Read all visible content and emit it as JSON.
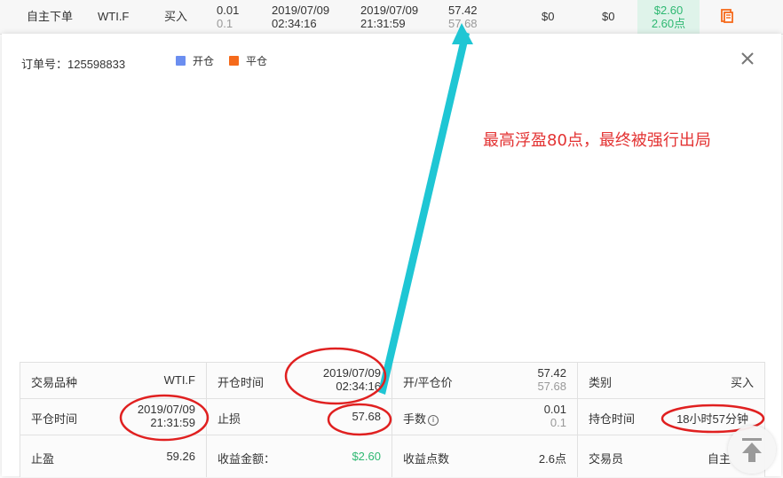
{
  "top_row": {
    "type": "自主下单",
    "symbol": "WTI.F",
    "direction": "买入",
    "lots": "0.01",
    "lots_sub": "0.1",
    "open_date": "2019/07/09",
    "open_time": "02:34:16",
    "close_date": "2019/07/09",
    "close_time": "21:31:59",
    "price_open": "57.42",
    "price_close": "57.68",
    "fee1": "$0",
    "fee2": "$0",
    "profit": "$2.60",
    "profit_points": "2.60点",
    "icon": "document-icon"
  },
  "modal": {
    "order_label": "订单号：125598833",
    "legend": [
      {
        "label": "开仓",
        "color": "#6b8ef0"
      },
      {
        "label": "平仓",
        "color": "#f56a1b"
      }
    ],
    "close_icon": "close-icon",
    "annotation": "最高浮盈80点，最终被强行出局"
  },
  "details": {
    "row1": {
      "symbol_label": "交易品种",
      "symbol_value": "WTI.F",
      "open_time_label": "开仓时间",
      "open_date": "2019/07/09",
      "open_time": "02:34:16",
      "price_label": "开/平仓价",
      "price_open": "57.42",
      "price_close": "57.68",
      "category_label": "类别",
      "category_value": "买入"
    },
    "row2": {
      "close_time_label": "平仓时间",
      "close_date": "2019/07/09",
      "close_time": "21:31:59",
      "stop_loss_label": "止损",
      "stop_loss_value": "57.68",
      "lots_label": "手数",
      "lots_value": "0.01",
      "lots_sub": "0.1",
      "hold_label": "持仓时间",
      "hold_value": "18小时57分钟"
    },
    "row3": {
      "take_profit_label": "止盈",
      "take_profit_value": "59.26",
      "profit_label": "收益金额：",
      "profit_value": "$2.60",
      "points_label": "收益点数",
      "points_value": "2.6点",
      "trader_label": "交易员",
      "trader_value": "自主"
    }
  },
  "colors": {
    "annotation": "#e33333",
    "arrow": "#1fc6d4",
    "profit_green": "#2eb872"
  },
  "scroll_top_icon": "arrow-up-icon"
}
